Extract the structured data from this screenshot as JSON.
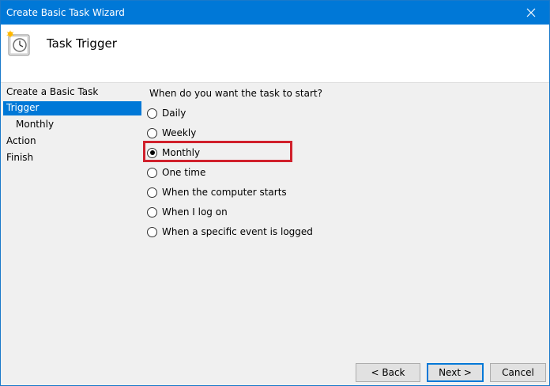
{
  "window": {
    "title": "Create Basic Task Wizard"
  },
  "header": {
    "title": "Task Trigger"
  },
  "sidebar": {
    "items": [
      {
        "label": "Create a Basic Task"
      },
      {
        "label": "Trigger"
      },
      {
        "label": "Monthly"
      },
      {
        "label": "Action"
      },
      {
        "label": "Finish"
      }
    ],
    "selected": "Trigger"
  },
  "main": {
    "question": "When do you want the task to start?",
    "options": [
      {
        "label": "Daily",
        "checked": false
      },
      {
        "label": "Weekly",
        "checked": false
      },
      {
        "label": "Monthly",
        "checked": true
      },
      {
        "label": "One time",
        "checked": false
      },
      {
        "label": "When the computer starts",
        "checked": false
      },
      {
        "label": "When I log on",
        "checked": false
      },
      {
        "label": "When a specific event is logged",
        "checked": false
      }
    ],
    "highlight_color": "#d0202c"
  },
  "buttons": {
    "back": "< Back",
    "next": "Next >",
    "cancel": "Cancel"
  },
  "colors": {
    "titlebar": "#0078d7",
    "selection": "#0078d7"
  },
  "icons": {
    "header": "task-scheduler-clock-icon",
    "close": "close-icon"
  }
}
